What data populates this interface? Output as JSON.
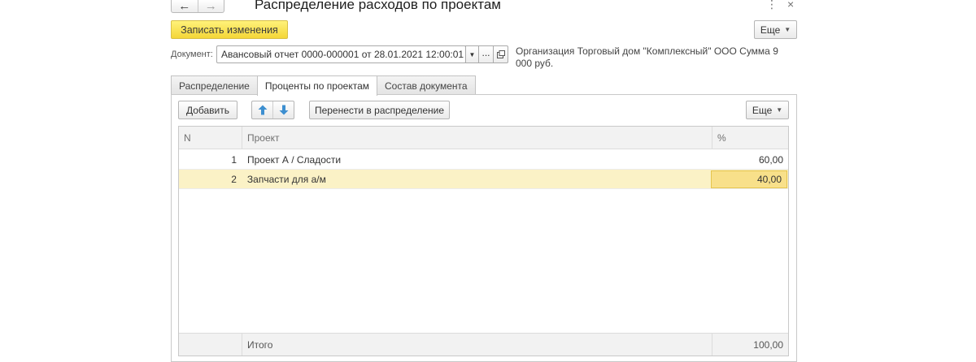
{
  "window": {
    "title": "Распределение расходов по проектам",
    "back_icon": "←",
    "forward_icon": "→",
    "menu_icon": "⋮",
    "close_icon": "×"
  },
  "toolbar": {
    "save_label": "Записать изменения",
    "more_label": "Еще"
  },
  "document": {
    "label": "Документ:",
    "value": "Авансовый отчет 0000-000001 от 28.01.2021 12:00:01",
    "select_label": "...",
    "info": "Организация Торговый дом \"Комплексный\" ООО Сумма 9 000 руб."
  },
  "tabs": [
    {
      "label": "Распределение",
      "active": false
    },
    {
      "label": "Проценты по проектам",
      "active": true
    },
    {
      "label": "Состав документа",
      "active": false
    }
  ],
  "table_toolbar": {
    "add_label": "Добавить",
    "transfer_label": "Перенести в распределение",
    "more_label": "Еще"
  },
  "grid": {
    "columns": {
      "n": "N",
      "project": "Проект",
      "percent": "%"
    },
    "rows": [
      {
        "n": "1",
        "project": "Проект А / Сладости",
        "percent": "60,00"
      },
      {
        "n": "2",
        "project": "Запчасти для а/м",
        "percent": "40,00"
      }
    ],
    "footer": {
      "label": "Итого",
      "total": "100,00"
    }
  },
  "colors": {
    "save_button": "#f4d637",
    "selected_row": "#fbf2c6",
    "focused_cell": "#f8e08a",
    "arrow_icons": "#3d8fd0"
  }
}
